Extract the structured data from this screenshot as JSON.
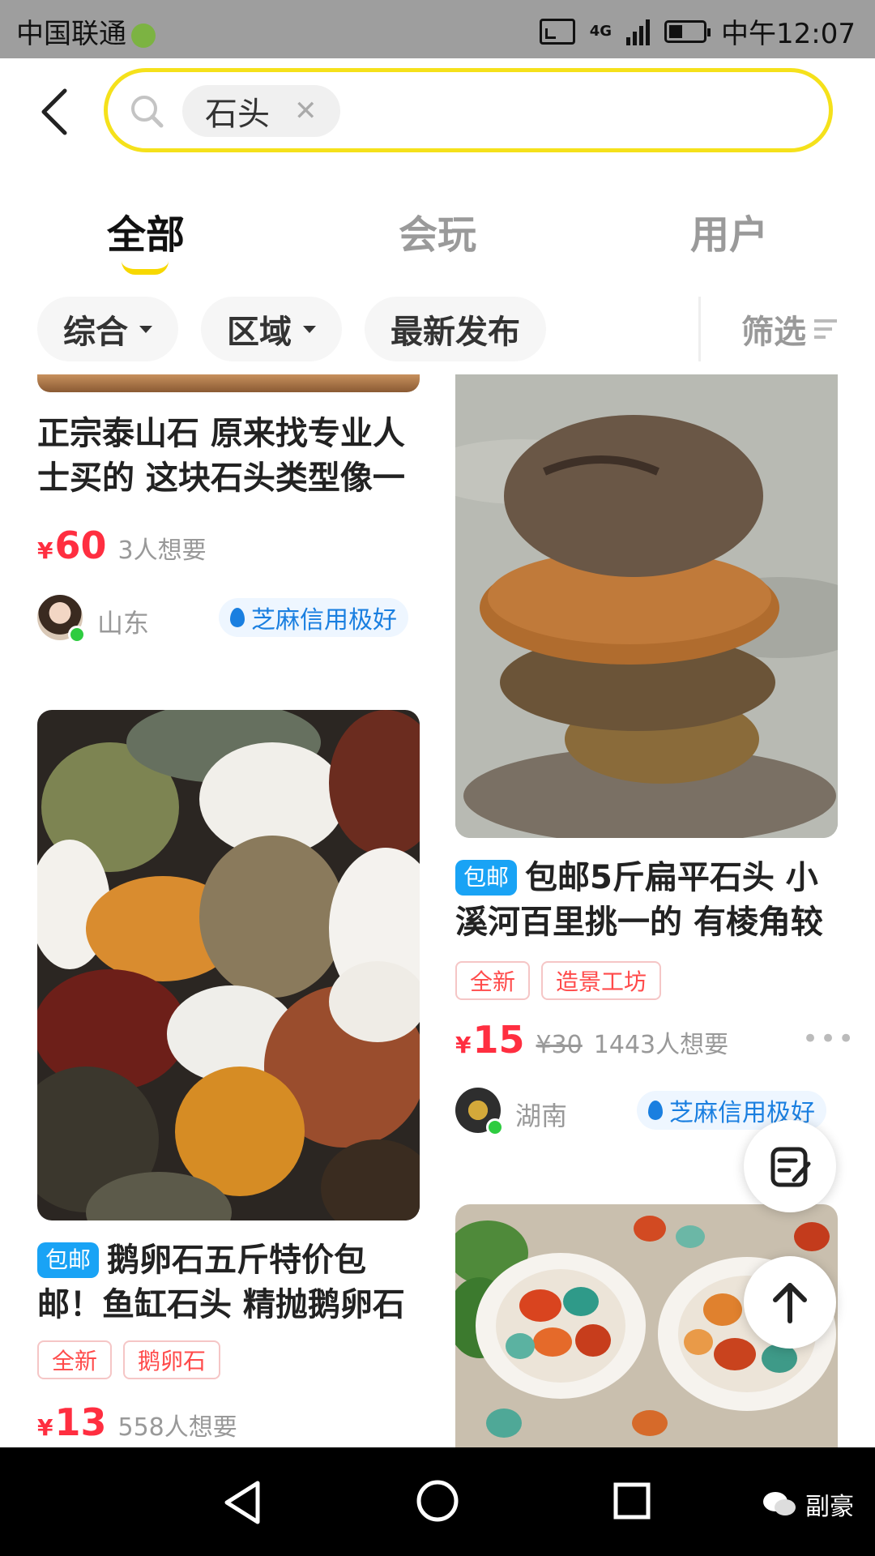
{
  "status_bar": {
    "carrier": "中国联通",
    "time": "中午12:07",
    "network": "4G"
  },
  "search": {
    "query": "石头"
  },
  "tabs": [
    {
      "label": "全部"
    },
    {
      "label": "会玩"
    },
    {
      "label": "用户"
    }
  ],
  "filters": {
    "sort": "综合",
    "region": "区域",
    "latest": "最新发布",
    "filter": "筛选"
  },
  "items": [
    {
      "title": "正宗泰山石 原来找专业人士买的 这块石头类型像一",
      "price": "60",
      "wants": "3人想要",
      "location": "山东",
      "credit": "芝麻信用极好"
    },
    {
      "badge": "包邮",
      "title": "包邮5斤扁平石头 小溪河百里挑一的 有棱角较",
      "tags": [
        "全新",
        "造景工坊"
      ],
      "price": "15",
      "original_price": "¥30",
      "wants": "1443人想要",
      "location": "湖南",
      "credit": "芝麻信用极好"
    },
    {
      "badge": "包邮",
      "title": "鹅卵石五斤特价包邮！鱼缸石头 精抛鹅卵石",
      "tags": [
        "全新",
        "鹅卵石"
      ],
      "price": "13",
      "wants": "558人想要"
    }
  ],
  "currency": "¥",
  "watermark": "副豪"
}
